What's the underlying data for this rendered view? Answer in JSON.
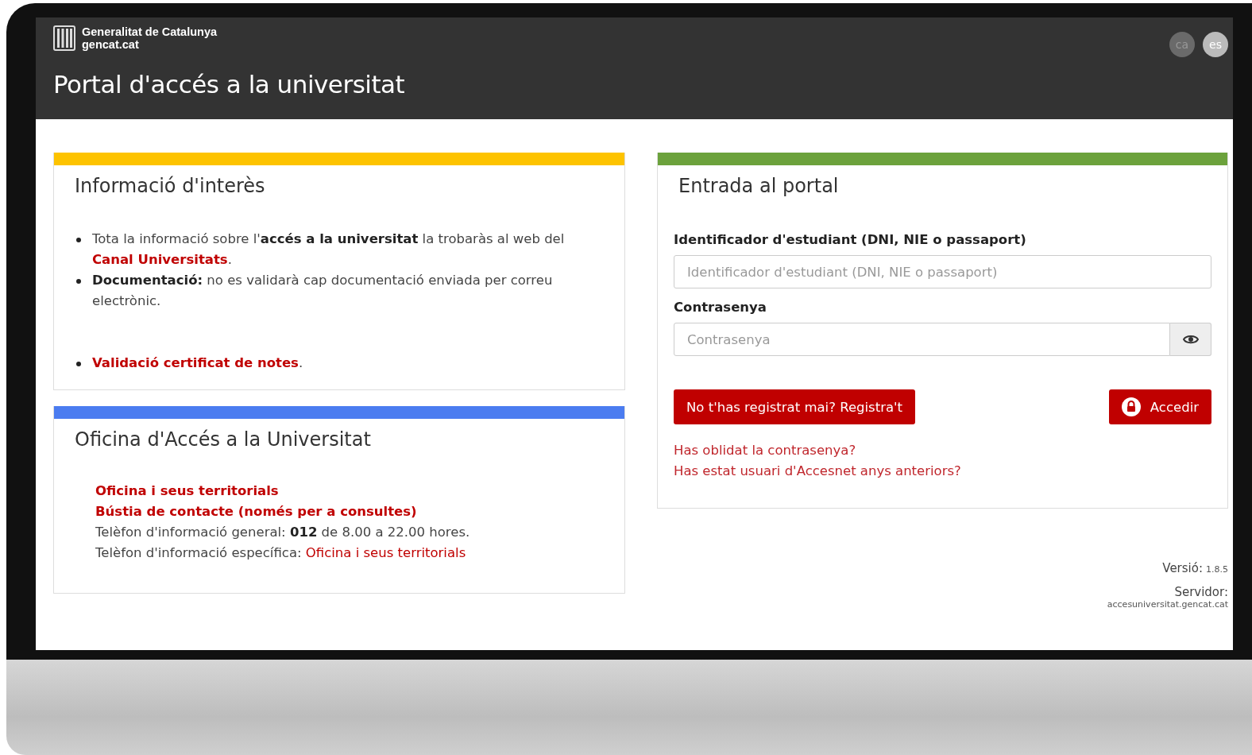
{
  "header": {
    "org": "Generalitat de Catalunya",
    "site": "gencat.cat",
    "title": "Portal d'accés a la universitat",
    "languages": [
      {
        "label": "ca",
        "selected": true
      },
      {
        "label": "es",
        "selected": false
      }
    ]
  },
  "info_panel": {
    "title": "Informació d'interès",
    "items": [
      {
        "segments": [
          {
            "kind": "text",
            "text": "Tota la informació sobre l'"
          },
          {
            "kind": "bold",
            "text": "accés a la universitat"
          },
          {
            "kind": "text",
            "text": " la trobaràs al web del "
          },
          {
            "kind": "strong_link",
            "text": "Canal Universitats"
          },
          {
            "kind": "text",
            "text": "."
          }
        ]
      },
      {
        "segments": [
          {
            "kind": "bold",
            "text": "Documentació:"
          },
          {
            "kind": "text",
            "text": " no es validarà cap documentació enviada per correu electrònic."
          }
        ]
      },
      {
        "segments": [
          {
            "kind": "strong_link",
            "text": "Validació certificat de notes"
          },
          {
            "kind": "text",
            "text": "."
          }
        ]
      }
    ]
  },
  "office_panel": {
    "title": "Oficina d'Accés a la Universitat",
    "lines": [
      {
        "segments": [
          {
            "kind": "strong_link",
            "text": "Oficina i seus territorials"
          }
        ]
      },
      {
        "segments": [
          {
            "kind": "strong_link",
            "text": "Bústia de contacte (només per a consultes)"
          }
        ]
      },
      {
        "segments": [
          {
            "kind": "text",
            "text": "Telèfon d'informació general: "
          },
          {
            "kind": "bold",
            "text": "012"
          },
          {
            "kind": "text",
            "text": " de 8.00 a 22.00 hores."
          }
        ]
      },
      {
        "segments": [
          {
            "kind": "text",
            "text": "Telèfon d'informació específica: "
          },
          {
            "kind": "link",
            "text": "Oficina i seus territorials"
          }
        ]
      }
    ]
  },
  "login_panel": {
    "title": "Entrada al portal",
    "id_label": "Identificador d'estudiant (DNI, NIE o passaport)",
    "id_placeholder": "Identificador d'estudiant (DNI, NIE o passaport)",
    "password_label": "Contrasenya",
    "password_placeholder": "Contrasenya",
    "register_button": "No t'has registrat mai? Registra't",
    "login_button": "Accedir",
    "links": [
      "Has oblidat la contrasenya?",
      "Has estat usuari d'Accesnet anys anteriors?"
    ]
  },
  "footer": {
    "version_label": "Versió:",
    "version": "1.8.5",
    "server_label": "Servidor:",
    "server": "accesuniversitat.gencat.cat"
  }
}
